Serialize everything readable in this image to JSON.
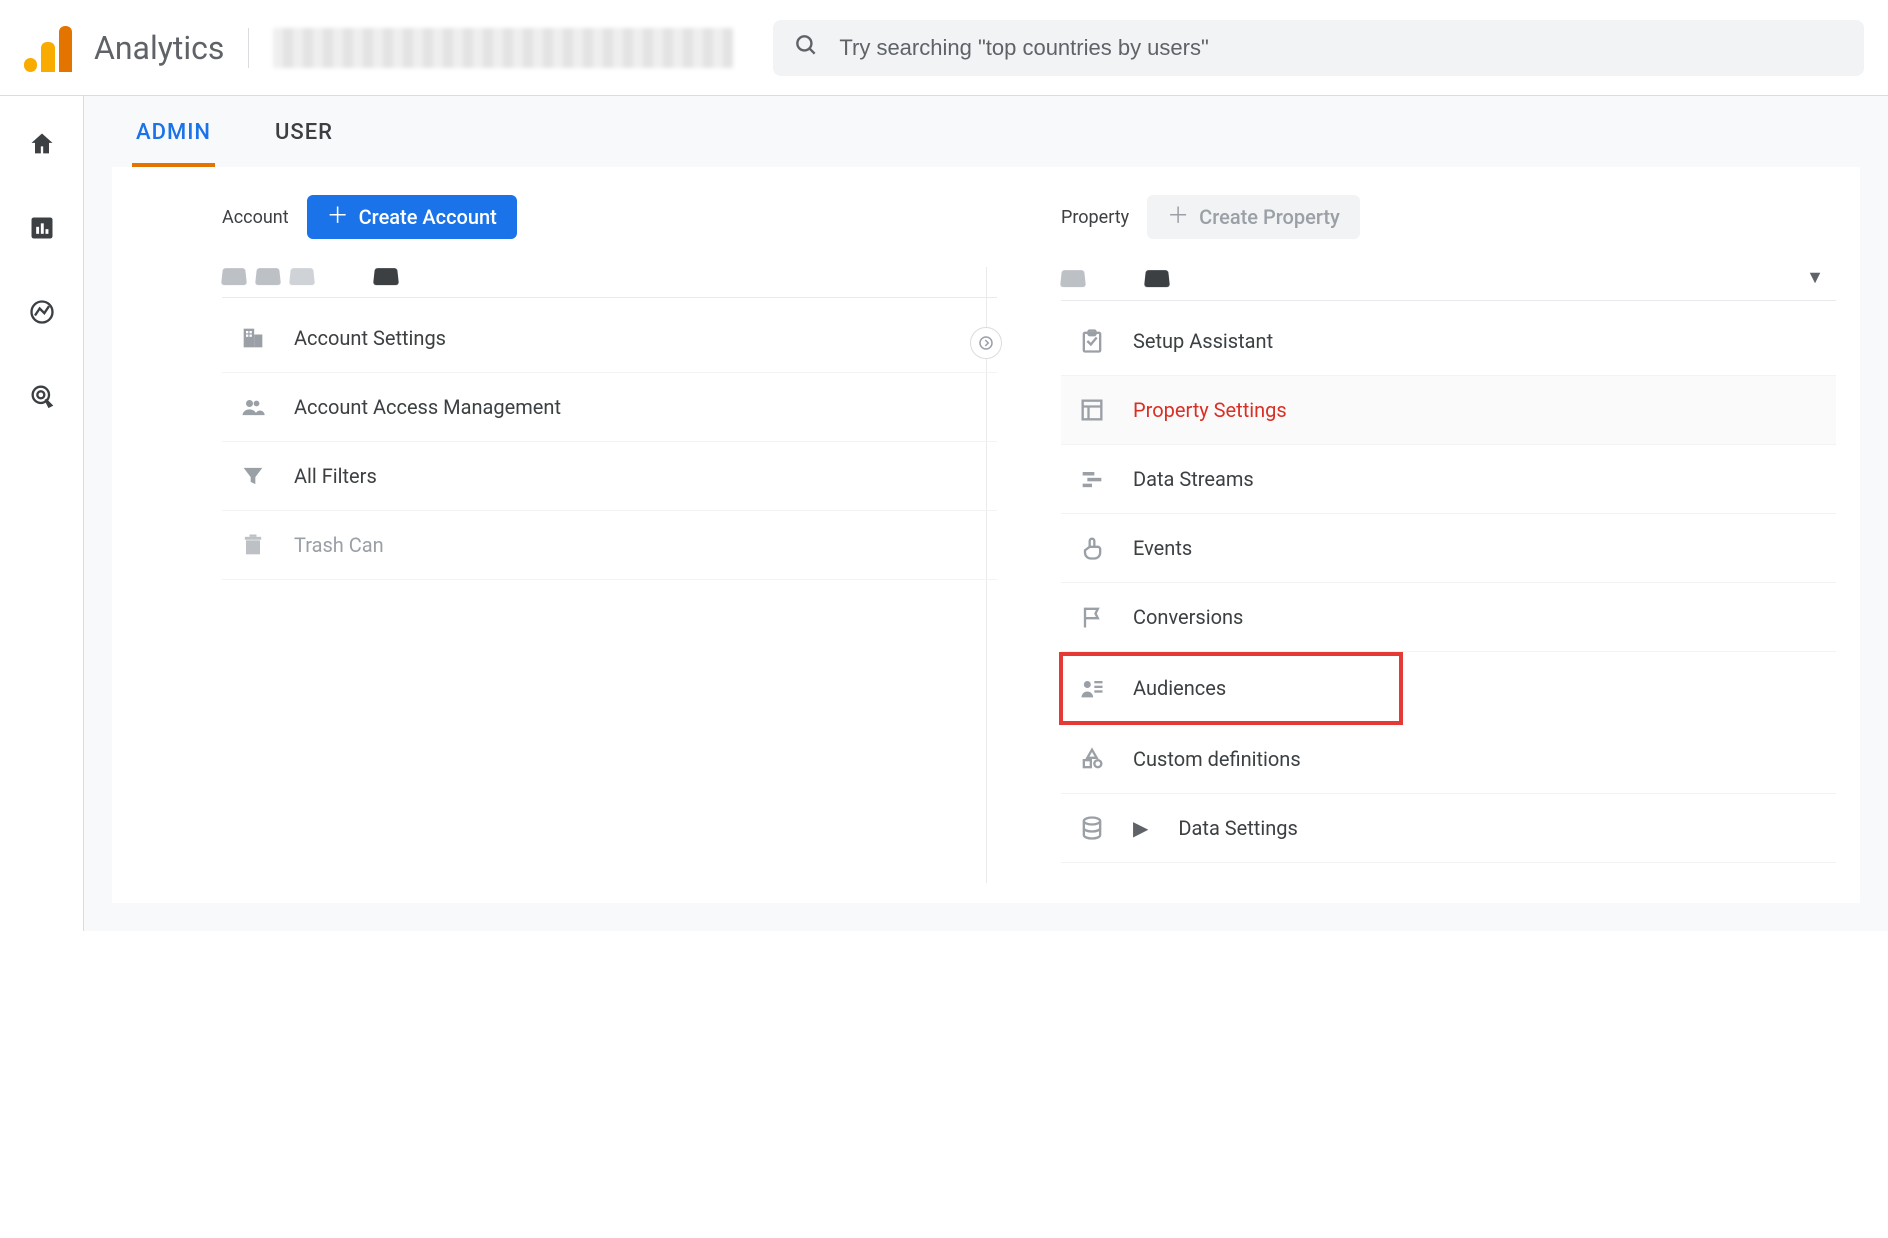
{
  "header": {
    "app_title": "Analytics",
    "search_placeholder": "Try searching \"top countries by users\""
  },
  "tabs": {
    "admin": "ADMIN",
    "user": "USER"
  },
  "account_col": {
    "title": "Account",
    "create_btn": "Create Account",
    "items": [
      {
        "label": "Account Settings"
      },
      {
        "label": "Account Access Management"
      },
      {
        "label": "All Filters"
      },
      {
        "label": "Trash Can"
      }
    ]
  },
  "property_col": {
    "title": "Property",
    "create_btn": "Create Property",
    "items": [
      {
        "label": "Setup Assistant"
      },
      {
        "label": "Property Settings"
      },
      {
        "label": "Data Streams"
      },
      {
        "label": "Events"
      },
      {
        "label": "Conversions"
      },
      {
        "label": "Audiences"
      },
      {
        "label": "Custom definitions"
      },
      {
        "label": "Data Settings"
      }
    ]
  }
}
